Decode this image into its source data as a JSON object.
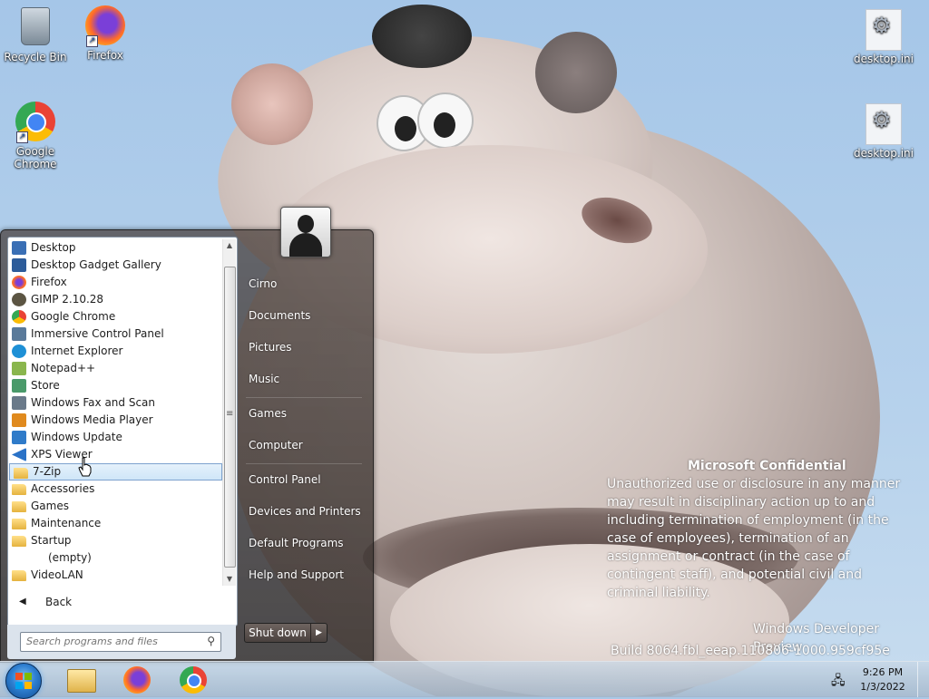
{
  "desktop": {
    "icons": [
      {
        "label": "Recycle Bin",
        "icon": "recycle-bin-icon"
      },
      {
        "label": "Firefox",
        "icon": "firefox-icon"
      },
      {
        "label": "Google Chrome",
        "icon": "chrome-icon"
      },
      {
        "label": "desktop.ini",
        "icon": "settings-file-icon"
      },
      {
        "label": "desktop.ini",
        "icon": "settings-file-icon"
      }
    ]
  },
  "watermark": {
    "title": "Microsoft Confidential",
    "body": "Unauthorized use or disclosure in any manner may result in disciplinary action up to and including termination of employment (in the case of employees), termination of an assignment or contract (in the case of contingent staff), and potential civil and criminal liability.",
    "os": "Windows Developer Preview",
    "build": "Build 8064.fbl_eeap.110806-1000.959cf95e"
  },
  "start_menu": {
    "programs": [
      {
        "label": "Desktop",
        "icon": "desktop-icon",
        "color": "#3a6fb5"
      },
      {
        "label": "Desktop Gadget Gallery",
        "icon": "gadget-icon",
        "color": "#2d5c9a"
      },
      {
        "label": "Firefox",
        "icon": "firefox-icon",
        "color": "#e66000"
      },
      {
        "label": "GIMP 2.10.28",
        "icon": "gimp-icon",
        "color": "#5c5543"
      },
      {
        "label": "Google Chrome",
        "icon": "chrome-icon",
        "color": "#34a853"
      },
      {
        "label": "Immersive Control Panel",
        "icon": "control-panel-icon",
        "color": "#5a7a9a"
      },
      {
        "label": "Internet Explorer",
        "icon": "ie-icon",
        "color": "#1e90d6"
      },
      {
        "label": "Notepad++",
        "icon": "notepad-plus-plus-icon",
        "color": "#8ab64d"
      },
      {
        "label": "Store",
        "icon": "store-icon",
        "color": "#4a9a6a"
      },
      {
        "label": "Windows Fax and Scan",
        "icon": "fax-icon",
        "color": "#6a7a8a"
      },
      {
        "label": "Windows Media Player",
        "icon": "media-player-icon",
        "color": "#e08a1e"
      },
      {
        "label": "Windows Update",
        "icon": "windows-update-icon",
        "color": "#2f7bc9"
      },
      {
        "label": "XPS Viewer",
        "icon": "xps-viewer-icon",
        "color": "#2a72c7"
      }
    ],
    "folders": [
      {
        "label": "7-Zip",
        "selected": true
      },
      {
        "label": "Accessories",
        "selected": false
      },
      {
        "label": "Games",
        "selected": false
      },
      {
        "label": "Maintenance",
        "selected": false
      },
      {
        "label": "Startup",
        "selected": false
      }
    ],
    "startup_empty": "(empty)",
    "videolan": "VideoLAN",
    "back_label": "Back",
    "search_placeholder": "Search programs and files",
    "right_pane": {
      "user": "Cirno",
      "documents": "Documents",
      "pictures": "Pictures",
      "music": "Music",
      "games": "Games",
      "computer": "Computer",
      "control_panel": "Control Panel",
      "devices_printers": "Devices and Printers",
      "default_programs": "Default Programs",
      "help_support": "Help and Support"
    },
    "shutdown_label": "Shut down"
  },
  "taskbar": {
    "pinned": [
      "windows-explorer-icon",
      "firefox-icon",
      "chrome-icon"
    ],
    "time": "9:26 PM",
    "date": "1/3/2022"
  }
}
